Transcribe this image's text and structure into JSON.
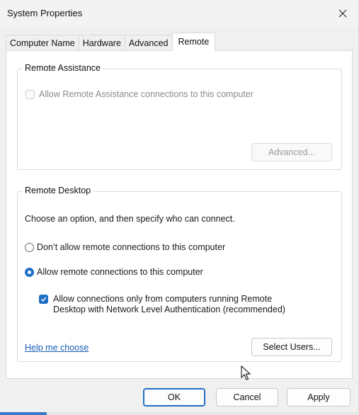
{
  "window": {
    "title": "System Properties"
  },
  "tabs": [
    {
      "label": "Computer Name"
    },
    {
      "label": "Hardware"
    },
    {
      "label": "Advanced"
    },
    {
      "label": "Remote",
      "active": true
    }
  ],
  "remote_assistance": {
    "legend": "Remote Assistance",
    "allow_label": "Allow Remote Assistance connections to this computer",
    "allow_checked": false,
    "advanced_button": "Advanced..."
  },
  "remote_desktop": {
    "legend": "Remote Desktop",
    "instruction": "Choose an option, and then specify who can connect.",
    "option_dont_allow": "Don’t allow remote connections to this computer",
    "option_allow": "Allow remote connections to this computer",
    "selected": "allow",
    "nla_label_line1": "Allow connections only from computers running Remote",
    "nla_label_line2": "Desktop with Network Level Authentication (recommended)",
    "nla_checked": true,
    "help_link": "Help me choose",
    "select_users_button": "Select Users..."
  },
  "footer": {
    "ok_label": "OK",
    "cancel_label": "Cancel",
    "apply_label": "Apply"
  },
  "colors": {
    "accent": "#1f6fc4",
    "link": "#1a5fb4",
    "disabled_text": "#8a8a8a"
  }
}
